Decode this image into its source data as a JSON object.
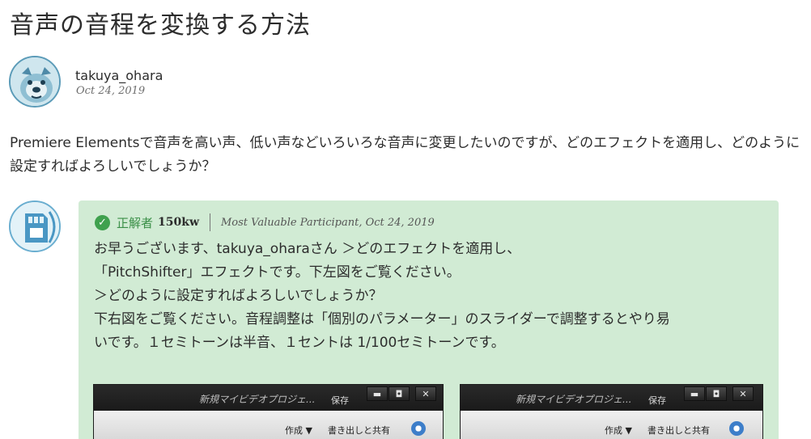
{
  "page": {
    "title": "音声の音程を変換する方法"
  },
  "post": {
    "author": "takuya_ohara",
    "date": "Oct 24, 2019",
    "body": "Premiere Elementsで音声を高い声、低い声などいろいろな音声に変更したいのですが、どのエフェクトを適用し、どのように設定すればよろしいでしょうか？"
  },
  "answer": {
    "badge": "正解者",
    "author": "150kw",
    "rank": "Most Valuable Participant, Oct 24, 2019",
    "lines": [
      "お早うございます、takuya_oharaさん ＞どのエフェクトを適用し、",
      "「PitchShifter」エフェクトです。下左図をご覧ください。",
      "＞どのように設定すればよろしいでしょうか？",
      "下右図をご覧ください。音程調整は「個別のパラメーター」のスライダーで調整するとやり易",
      "いです。１セミトーンは半音、１セントは 1/100セミトーンです。"
    ]
  },
  "screenshots": {
    "left": {
      "project": "新規マイビデオプロジェ...",
      "save": "保存",
      "minimize": "▬",
      "maximize": "◘",
      "close": "✕",
      "menu_create": "作成 ▼",
      "menu_share": "書き出しと共有"
    },
    "right": {
      "project": "新規マイビデオプロジェ...",
      "save": "保存",
      "minimize": "▬",
      "maximize": "◘",
      "close": "✕",
      "menu_create": "作成 ▼",
      "menu_share": "書き出しと共有"
    }
  },
  "colors": {
    "answer_bg": "#d1ebd4",
    "accepted_green": "#3fa14e"
  },
  "icons": {
    "accepted": "check-circle-icon",
    "settings": "gear-icon"
  }
}
